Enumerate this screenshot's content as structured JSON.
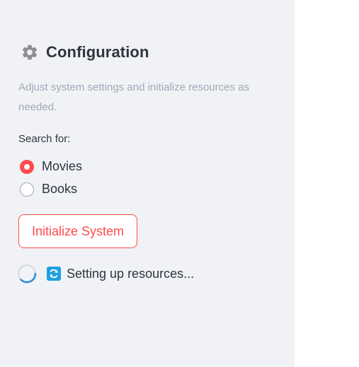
{
  "sidebar": {
    "header": {
      "icon": "gear-icon",
      "title": "Configuration"
    },
    "caption": "Adjust system settings and initialize resources as needed.",
    "radio": {
      "label": "Search for:",
      "options": [
        {
          "label": "Movies",
          "selected": true
        },
        {
          "label": "Books",
          "selected": false
        }
      ]
    },
    "init_button": {
      "label": "Initialize System"
    },
    "status": {
      "spinner_icon": "spinner-icon",
      "icon": "refresh-icon",
      "text": "Setting up resources..."
    }
  },
  "colors": {
    "sidebar_bg": "#f0f2f6",
    "accent": "#ff4b4b",
    "text": "#31333f",
    "muted_text": "#a3a8b8",
    "spinner": "#2a8bd6",
    "status_icon_bg": "#1ba0df"
  }
}
